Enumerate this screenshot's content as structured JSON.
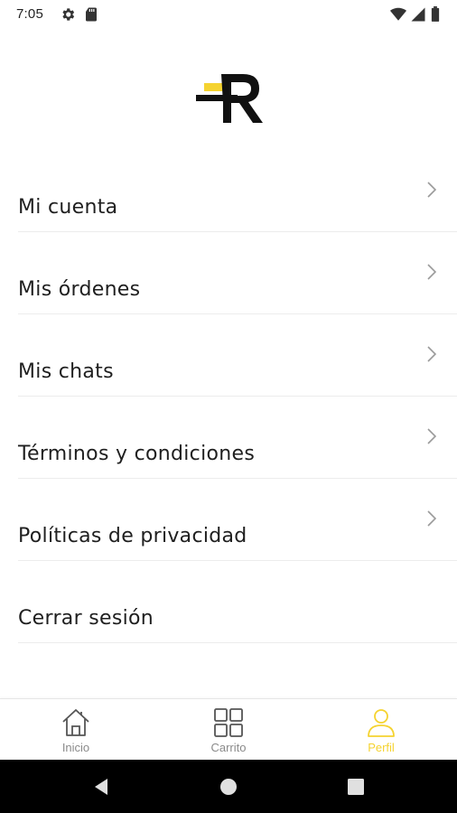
{
  "status_bar": {
    "time": "7:05",
    "icons": [
      "settings-icon",
      "sd-card-icon",
      "wifi-icon",
      "signal-icon",
      "battery-icon"
    ]
  },
  "logo": {
    "name": "R logo",
    "colors": {
      "primary": "#111111",
      "accent": "#f5d330"
    }
  },
  "menu": {
    "items": [
      {
        "label": "Mi cuenta",
        "chevron": true
      },
      {
        "label": "Mis órdenes",
        "chevron": true
      },
      {
        "label": "Mis chats",
        "chevron": true
      },
      {
        "label": "Términos y condiciones",
        "chevron": true
      },
      {
        "label": "Políticas de privacidad",
        "chevron": true
      },
      {
        "label": "Cerrar sesión",
        "chevron": false
      }
    ]
  },
  "bottom_nav": {
    "items": [
      {
        "label": "Inicio",
        "icon": "home-icon",
        "active": false
      },
      {
        "label": "Carrito",
        "icon": "grid-icon",
        "active": false
      },
      {
        "label": "Perfil",
        "icon": "user-icon",
        "active": true
      }
    ],
    "active_color": "#f5d330",
    "inactive_color": "#8a8a8a"
  },
  "system_nav": {
    "buttons": [
      "back-icon",
      "home-circle-icon",
      "recents-icon"
    ]
  }
}
